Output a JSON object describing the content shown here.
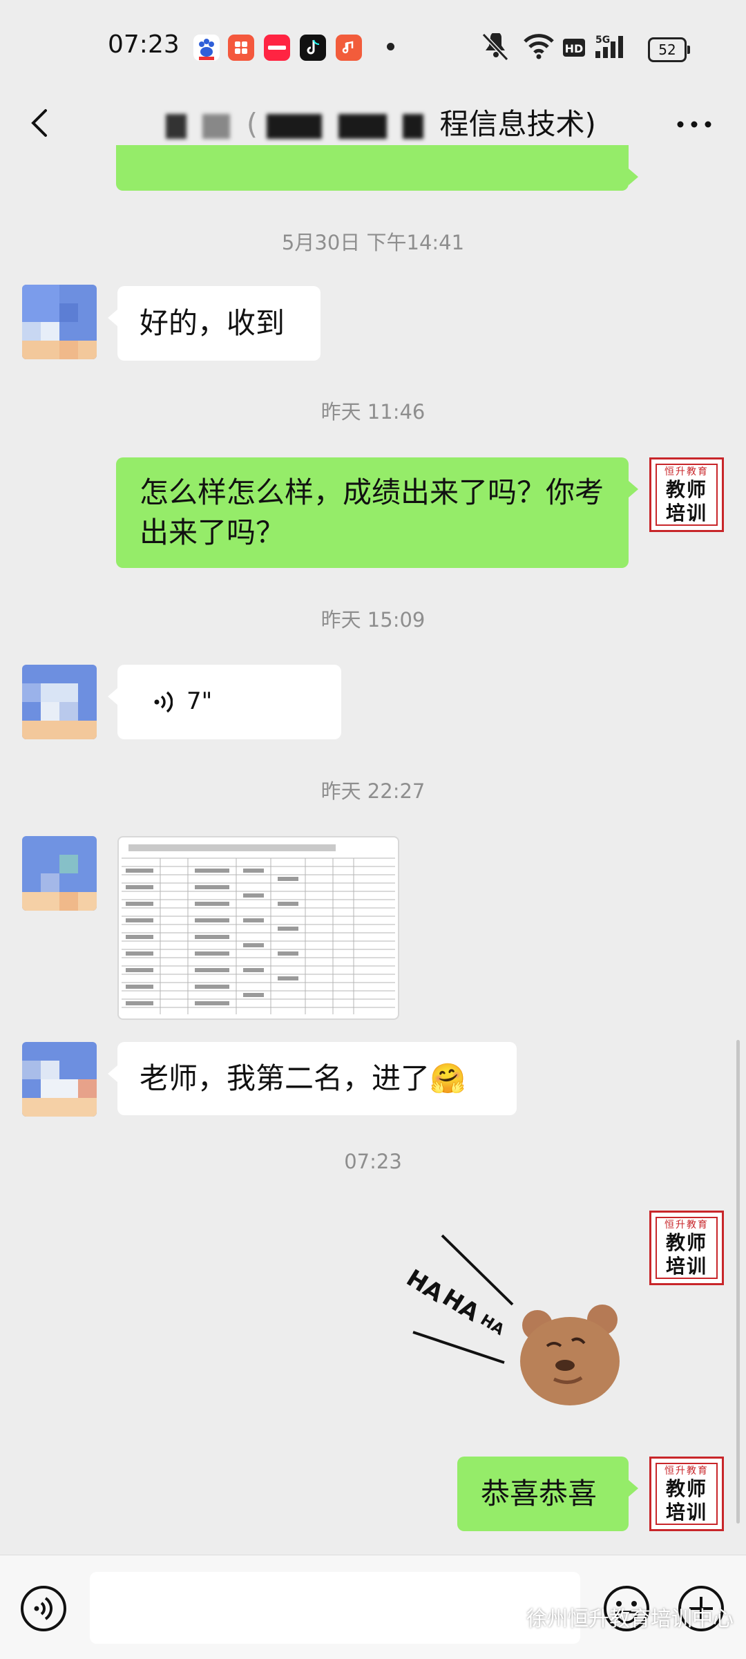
{
  "status_bar": {
    "time": "07:23",
    "battery": "52",
    "app_icons": [
      "baidu-icon",
      "app-icon",
      "xiaohongshu-icon",
      "tiktok-icon",
      "music-icon"
    ]
  },
  "header": {
    "title_visible": "程信息技术)",
    "title_left_paren": "("
  },
  "timestamps": [
    "5月30日 下午14:41",
    "昨天 11:46",
    "昨天 15:09",
    "昨天 22:27",
    "07:23"
  ],
  "messages": {
    "m1": "好的，收到",
    "m2": "怎么样怎么样，成绩出来了吗？你考出来了吗？",
    "voice_duration": "7\"",
    "m4": "老师，我第二名，进了",
    "m4_emoji": "🤗",
    "sticker_text": "HA HA HA",
    "m6": "恭喜恭喜"
  },
  "seal": {
    "top": "恒升教育",
    "line1": "教师",
    "line2": "培训"
  },
  "watermark": "徐州恒升教育培训中心",
  "colors": {
    "background": "#ededed",
    "bubble_self": "#95ec69",
    "bubble_other": "#ffffff",
    "seal_red": "#c8262a",
    "timestamp": "#8e8e8e"
  }
}
